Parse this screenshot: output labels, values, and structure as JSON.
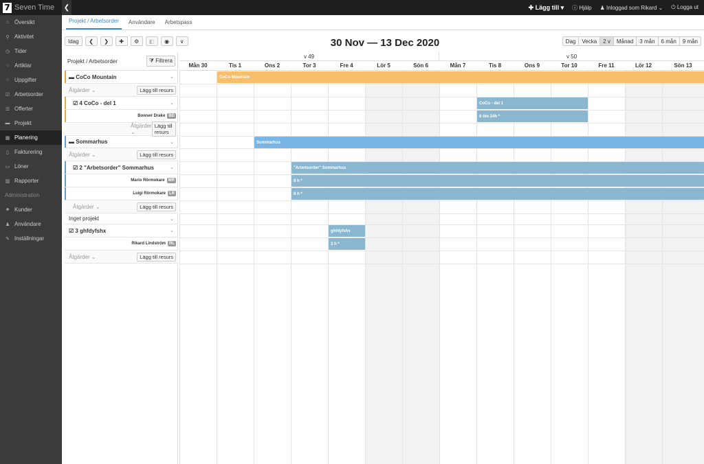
{
  "app": {
    "logo_digit": "7",
    "name": "Seven Time",
    "collapse_glyph": "❮"
  },
  "topbar": {
    "add": "✚ Lägg till ▾",
    "help": "ⓘ Hjälp",
    "user": "♟ Inloggad som Rikard ⌄",
    "logout": "⏻ Logga ut"
  },
  "sidebar": {
    "items": [
      {
        "label": "Översikt",
        "icon": "home-icon",
        "glyph": "⌂"
      },
      {
        "label": "Aktivitet",
        "icon": "pin-icon",
        "glyph": "⚲"
      },
      {
        "label": "Tider",
        "icon": "clock-icon",
        "glyph": "◷"
      },
      {
        "label": "Artiklar",
        "icon": "circle-icon",
        "glyph": "○"
      },
      {
        "label": "Uppgifter",
        "icon": "circle-icon",
        "glyph": "○"
      },
      {
        "label": "Arbetsorder",
        "icon": "check-icon",
        "glyph": "☑"
      },
      {
        "label": "Offerter",
        "icon": "list-icon",
        "glyph": "☰"
      },
      {
        "label": "Projekt",
        "icon": "folder-icon",
        "glyph": "▬"
      },
      {
        "label": "Planering",
        "icon": "calendar-icon",
        "glyph": "▦"
      },
      {
        "label": "Fakturering",
        "icon": "file-icon",
        "glyph": "▯"
      },
      {
        "label": "Löner",
        "icon": "card-icon",
        "glyph": "▭"
      },
      {
        "label": "Rapporter",
        "icon": "chart-icon",
        "glyph": "▥"
      }
    ],
    "admin_heading": "Administration",
    "admin_items": [
      {
        "label": "Kunder",
        "icon": "org-icon",
        "glyph": "♣"
      },
      {
        "label": "Användare",
        "icon": "user-icon",
        "glyph": "♟"
      },
      {
        "label": "Inställningar",
        "icon": "wrench-icon",
        "glyph": "✎"
      }
    ]
  },
  "tabs": [
    "Projekt / Arbetsorder",
    "Användare",
    "Arbetspass"
  ],
  "toolbar": {
    "today": "Idag",
    "prev": "❮",
    "next": "❯",
    "add": "✚",
    "settings": "⚙",
    "disabled": "◧",
    "view": "◉",
    "more": "∨"
  },
  "date_range": "30 Nov — 13 Dec 2020",
  "views": [
    "Dag",
    "Vecka",
    "2 v",
    "Månad",
    "3 mån",
    "6 mån",
    "9 mån"
  ],
  "left_header": {
    "title": "Projekt / Arbetsorder",
    "filter": "⧩ Filtrera"
  },
  "rows": {
    "r0": {
      "icon": "▬",
      "title": "CoCo Mountain",
      "chev": "⌄"
    },
    "r1": {
      "actions": "Åtgärder ⌄",
      "add": "Lägg till resurs"
    },
    "r2": {
      "icon": "☑",
      "title": "4 CoCo - del 1",
      "chev": "⌄"
    },
    "r3": {
      "name": "Bowser Drake",
      "initials": "BD"
    },
    "r4": {
      "actions": "Åtgärder ⌄",
      "add": "Lägg till resurs"
    },
    "r5": {
      "icon": "▬",
      "title": "Sommarhus",
      "chev": "⌄"
    },
    "r6": {
      "actions": "Åtgärder ⌄",
      "add": "Lägg till resurs"
    },
    "r7": {
      "icon": "☑",
      "title": "2 \"Arbetsorder\" Sommarhus",
      "chev": "⌄"
    },
    "r8": {
      "name": "Mario Rörmokare",
      "initials": "MR"
    },
    "r9": {
      "name": "Luigi Rörmokare",
      "initials": "LR"
    },
    "r10": {
      "actions": "Åtgärder ⌄",
      "add": "Lägg till resurs"
    },
    "r11": {
      "title": "Inget projekt",
      "chev": "⌄"
    },
    "r12": {
      "icon": "☑",
      "title": "3 ghfdyfshx",
      "chev": "⌄"
    },
    "r13": {
      "name": "Rikard Lindström",
      "initials": "RL"
    },
    "r14": {
      "actions": "Åtgärder ⌄",
      "add": "Lägg till resurs"
    }
  },
  "weeks": [
    "v 49",
    "v 50"
  ],
  "days": [
    "Mån 30",
    "Tis 1",
    "Ons 2",
    "Tor 3",
    "Fre 4",
    "Lör 5",
    "Sön 6",
    "Mån 7",
    "Tis 8",
    "Ons 9",
    "Tor 10",
    "Fre 11",
    "Lör 12",
    "Sön 13"
  ],
  "events": {
    "e1": "CoCo Mountain",
    "e2": "CoCo - del 1",
    "e3": "8 tim 24h *",
    "e4": "Sommarhus",
    "e5": "\"Arbetsorder\" Sommarhus",
    "e6": "8 h *",
    "e7": "8 h *",
    "e8": "ghfdyfshx",
    "e9": "3 h *"
  },
  "colors": {
    "orange": "#f7be6b",
    "blue": "#8ab6cf",
    "light_blue": "#79b6e6",
    "accent": "#3a8bc5"
  }
}
